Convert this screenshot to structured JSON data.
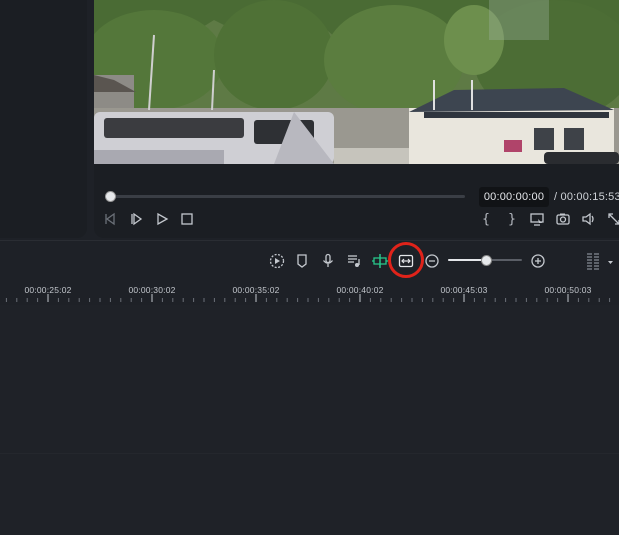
{
  "player": {
    "current_time": "00:00:00:00",
    "total_time": "/ 00:00:15:53",
    "progress": 0.0
  },
  "timeline": {
    "ruler_labels": [
      "00:00:25:02",
      "00:00:30:02",
      "00:00:35:02",
      "00:00:40:02",
      "00:00:45:03",
      "00:00:50:03"
    ],
    "zoom_level": 0.52
  },
  "icons": {
    "playback": [
      "step-back-icon",
      "step-forward-icon",
      "play-icon",
      "stop-icon"
    ],
    "right_controls": [
      "mark-in-icon",
      "mark-out-icon",
      "monitor-icon",
      "snapshot-icon",
      "volume-icon",
      "fullscreen-icon"
    ],
    "toolbar": [
      "auto-reframe-icon",
      "marker-icon",
      "voiceover-icon",
      "auto-beat-icon",
      "split-icon",
      "fit-timeline-icon",
      "zoom-out-icon",
      "zoom-in-icon",
      "audio-meter-icon",
      "dropdown-icon"
    ]
  },
  "colors": {
    "highlight": "#e0231a",
    "accent_green": "#28c78a"
  }
}
